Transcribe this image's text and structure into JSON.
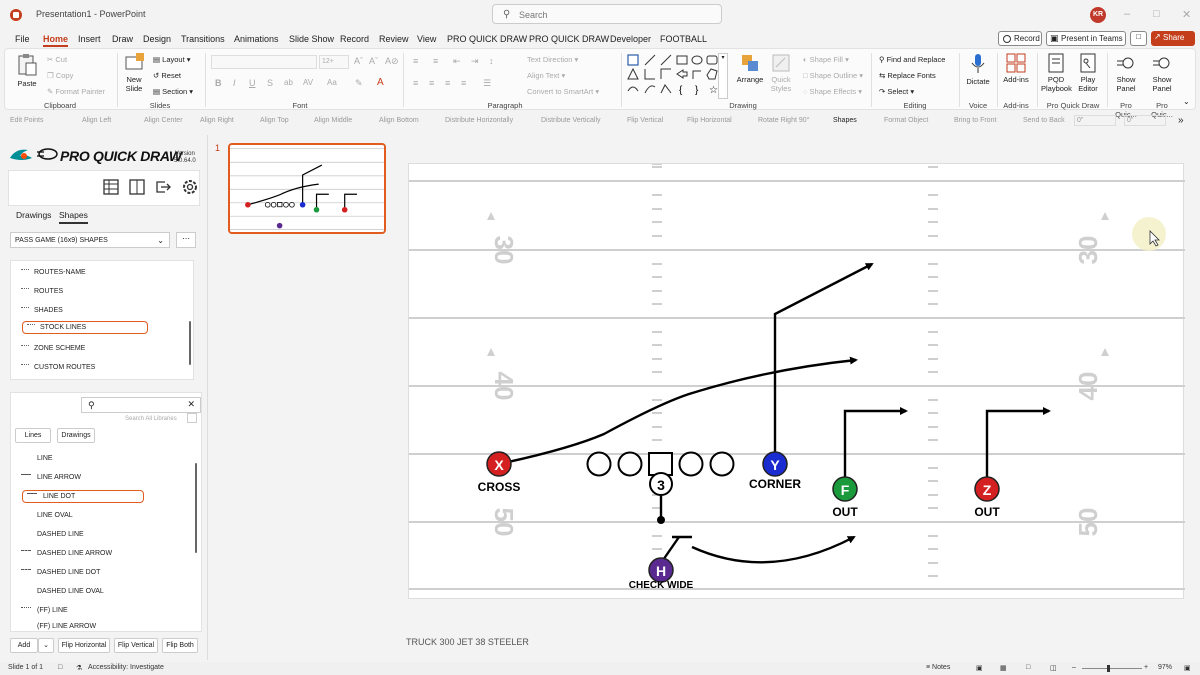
{
  "window": {
    "title": "Presentation1 - PowerPoint",
    "search_placeholder": "Search",
    "user_initials": "KR"
  },
  "menu": {
    "tabs": [
      "File",
      "Home",
      "Insert",
      "Draw",
      "Design",
      "Transitions",
      "Animations",
      "Slide Show",
      "Record",
      "Review",
      "View",
      "PRO QUICK DRAW",
      "PRO QUICK DRAW",
      "Developer",
      "FOOTBALL"
    ],
    "active_tab": "Home",
    "record_label": "Record",
    "teams_label": "Present in Teams",
    "share_label": "Share"
  },
  "ribbon": {
    "clipboard": {
      "paste": "Paste",
      "cut": "Cut",
      "copy": "Copy",
      "format_painter": "Format Painter",
      "group": "Clipboard"
    },
    "slides": {
      "new_slide": "New Slide",
      "layout": "Layout",
      "reset": "Reset",
      "section": "Section",
      "group": "Slides"
    },
    "font": {
      "size": "12+",
      "group": "Font"
    },
    "paragraph": {
      "text_direction": "Text Direction",
      "align_text": "Align Text",
      "convert_smartart": "Convert to SmartArt",
      "group": "Paragraph"
    },
    "drawing": {
      "arrange": "Arrange",
      "quick_styles": "Quick Styles",
      "shape_fill": "Shape Fill",
      "shape_outline": "Shape Outline",
      "shape_effects": "Shape Effects",
      "group": "Drawing"
    },
    "editing": {
      "find_replace": "Find and Replace",
      "replace_fonts": "Replace Fonts",
      "select": "Select",
      "group": "Editing"
    },
    "voice": {
      "dictate": "Dictate",
      "group": "Voice"
    },
    "addins": {
      "addins": "Add-ins",
      "group": "Add-ins"
    },
    "pqd": {
      "playbook": "PQD Playbook",
      "play_editor": "Play Editor",
      "group": "Pro Quick Draw"
    },
    "show_panel_1": {
      "label": "Show Panel",
      "group": "Pro Quic..."
    },
    "show_panel_2": {
      "label": "Show Panel",
      "group": "Pro Quic..."
    }
  },
  "pqd_toolbar": [
    "Edit Points",
    "Align Left",
    "Align Center",
    "Align Right",
    "Align Top",
    "Align Middle",
    "Align Bottom",
    "Distribute Horizontally",
    "Distribute Vertically",
    "Flip Vertical",
    "Flip Horizontal",
    "Rotate Right 90°",
    "Shapes",
    "Format Object",
    "Bring to Front",
    "Send to Back"
  ],
  "pqd_fields": {
    "field1": "0\"",
    "field2": "0\""
  },
  "left_pane": {
    "title": "PRO QUICK DRAW",
    "version_label": "Version",
    "version": "5.0.64.0",
    "subtabs": [
      "Drawings",
      "Shapes"
    ],
    "active_subtab": "Shapes",
    "library": "PASS GAME (16x9) SHAPES",
    "shape_items": [
      "ROUTES-NAME",
      "ROUTES",
      "SHADES",
      "STOCK LINES",
      "ZONE SCHEME",
      "CUSTOM ROUTES"
    ],
    "selected_shape": "STOCK LINES",
    "search_all": "Search All Libraries",
    "filter_buttons": [
      "Lines",
      "Drawings"
    ],
    "line_items": [
      "LINE",
      "LINE ARROW",
      "LINE DOT",
      "LINE OVAL",
      "DASHED LINE",
      "DASHED LINE ARROW",
      "DASHED LINE DOT",
      "DASHED LINE OVAL",
      "(FF) LINE",
      "(FF) LINE ARROW"
    ],
    "selected_line": "LINE DOT",
    "bottom_buttons": [
      "Add",
      "Flip Horizontal",
      "Flip Vertical",
      "Flip Both"
    ]
  },
  "thumbnail": {
    "slide_number": "1"
  },
  "slide": {
    "yard_labels_left": [
      "30",
      "40",
      "50"
    ],
    "yard_labels_right": [
      "30",
      "40",
      "50"
    ],
    "players": [
      {
        "letter": "X",
        "label": "CROSS",
        "color": "#d42020"
      },
      {
        "letter": "Y",
        "label": "CORNER",
        "color": "#1a2ccf"
      },
      {
        "letter": "F",
        "label": "OUT",
        "color": "#1a9a3a"
      },
      {
        "letter": "Z",
        "label": "OUT",
        "color": "#d42020"
      },
      {
        "letter": "H",
        "label": "CHECK WIDE",
        "color": "#5a2a90"
      },
      {
        "letter": "3",
        "label": "",
        "color": "#ffffff"
      }
    ]
  },
  "notes": "TRUCK 300 JET 38 STEELER",
  "status": {
    "slide_info": "Slide 1 of 1",
    "accessibility": "Accessibility: Investigate",
    "notes_btn": "Notes",
    "zoom": "97%"
  },
  "colors": {
    "accent": "#c43e1c",
    "selection": "#e25c20"
  }
}
